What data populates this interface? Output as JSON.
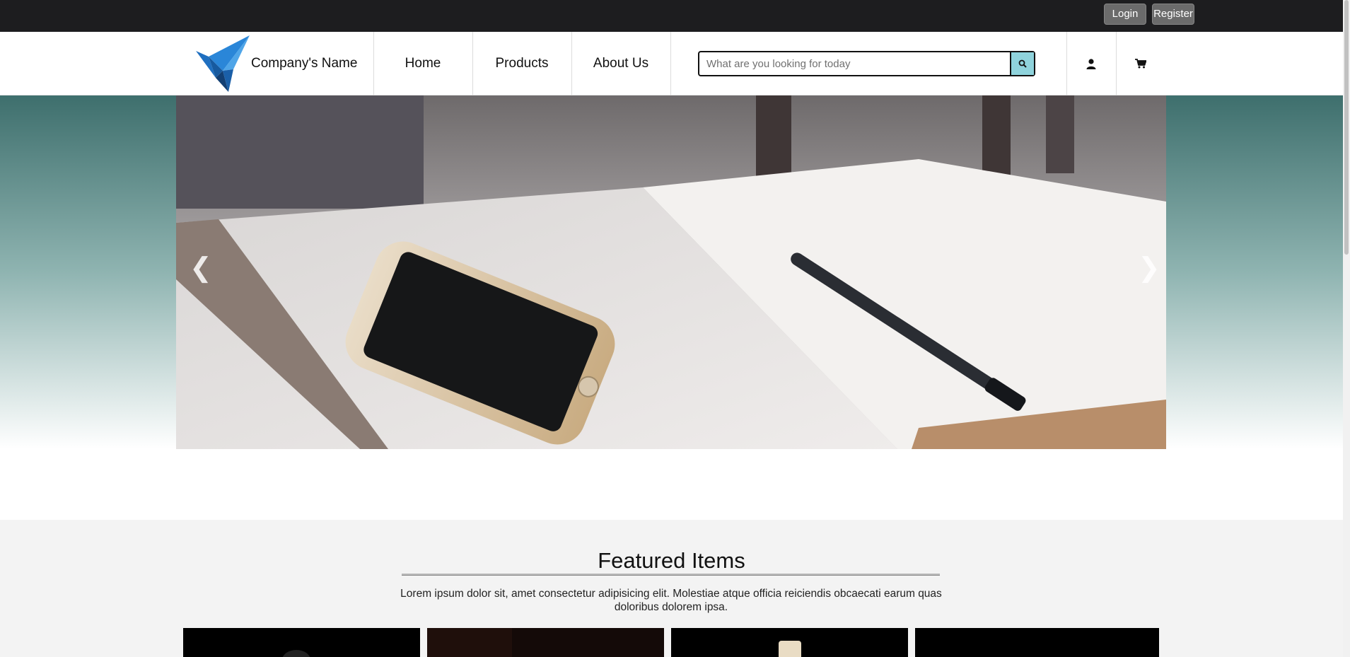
{
  "topbar": {
    "login_label": "Login",
    "register_label": "Register"
  },
  "header": {
    "brand": "Company's Name",
    "nav": [
      "Home",
      "Products",
      "About Us"
    ],
    "search": {
      "placeholder": "What are you looking for today",
      "value": ""
    },
    "icons": [
      "user-icon",
      "cart-icon"
    ]
  },
  "hero": {
    "image": "smartphone on open notebook with pen",
    "prev_icon": "chevron-left-icon",
    "next_icon": "chevron-right-icon",
    "prev_glyph": "❮",
    "next_glyph": "❯"
  },
  "featured": {
    "title": "Featured Items",
    "description": "Lorem ipsum dolor sit, amet consectetur adipisicing elit. Molestiae atque officia reiciendis obcaecati earum quas doloribus dolorem ipsa."
  },
  "colors": {
    "topbar": "#1d1d1f",
    "search_button": "#8fd3dc",
    "hero_gradient_top": "#3e6f6d",
    "featured_bg": "#f3f3f3"
  }
}
